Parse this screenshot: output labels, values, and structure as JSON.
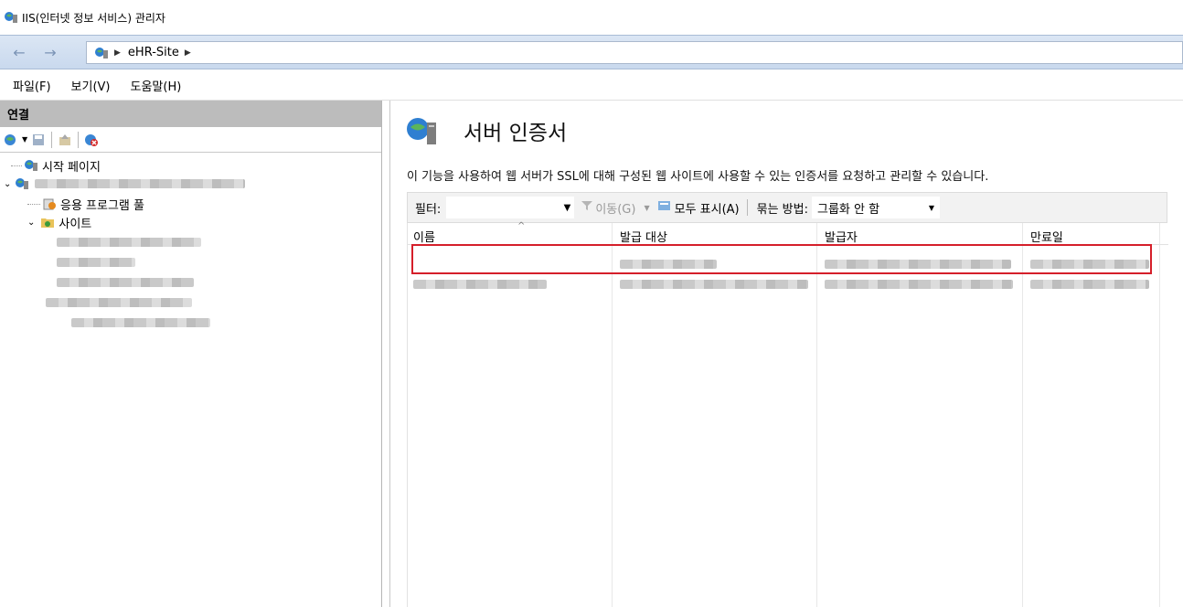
{
  "window": {
    "title": "IIS(인터넷 정보 서비스) 관리자"
  },
  "address": {
    "back_label": "←",
    "forward_label": "→",
    "crumbs": [
      "eHR-Site"
    ]
  },
  "menu": {
    "items": [
      "파일(F)",
      "보기(V)",
      "도움말(H)"
    ]
  },
  "connections": {
    "header": "연결",
    "tree": {
      "start_page": "시작 페이지",
      "app_pools": "응용 프로그램 풀",
      "sites": "사이트"
    }
  },
  "main": {
    "title": "서버 인증서",
    "description": "이 기능을 사용하여 웹 서버가 SSL에 대해 구성된 웹 사이트에 사용할 수 있는 인증서를 요청하고 관리할 수 있습니다.",
    "filter_label": "필터:",
    "go_label": "이동(G)",
    "show_all_label": "모두 표시(A)",
    "group_by_label": "묶는 방법:",
    "group_value": "그룹화 안 함",
    "columns": [
      "이름",
      "발급 대상",
      "발급자",
      "만료일"
    ]
  },
  "colors": {
    "highlight": "#d51f2a",
    "panel_header": "#bcbcbc"
  }
}
